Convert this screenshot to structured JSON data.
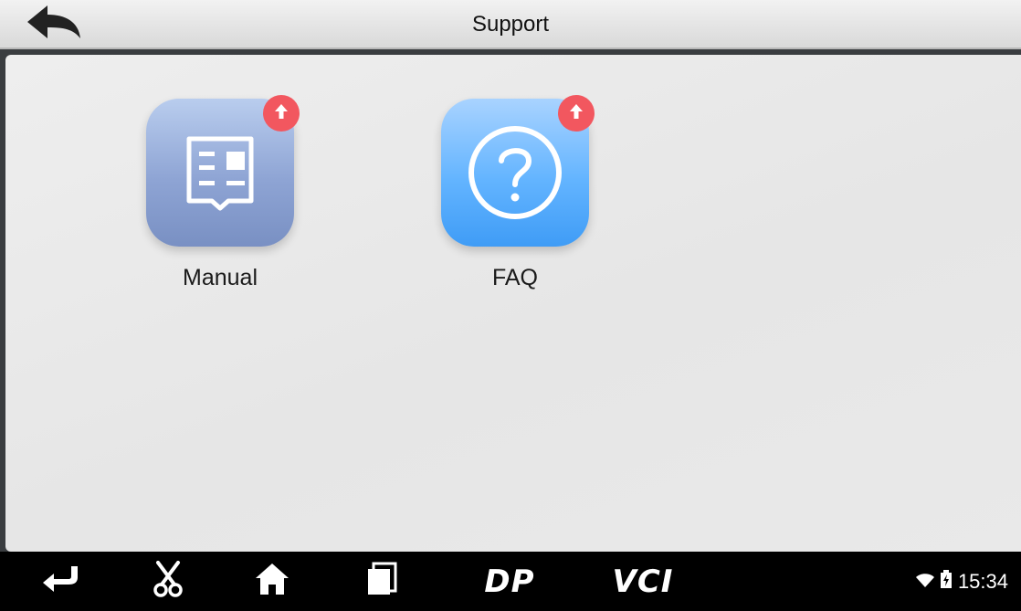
{
  "titlebar": {
    "title": "Support",
    "back_icon": "back-arrow-icon"
  },
  "apps": [
    {
      "label": "Manual",
      "icon": "manual-book-icon",
      "badge_icon": "upgrade-arrow-icon",
      "badge_color": "#f2575f"
    },
    {
      "label": "FAQ",
      "icon": "question-mark-icon",
      "badge_icon": "upgrade-arrow-icon",
      "badge_color": "#f2575f"
    }
  ],
  "navbar": {
    "items": [
      "back-nav-icon",
      "scissors-icon",
      "home-icon",
      "recent-apps-icon",
      "dp-icon",
      "vci-icon"
    ],
    "dp_label": "DP",
    "vci_label": "VCI"
  },
  "status": {
    "time": "15:34",
    "icons": [
      "wifi-icon",
      "battery-icon"
    ]
  },
  "colors": {
    "titlebar": "#e6e6e6",
    "navbar": "#000000",
    "badge": "#f2575f",
    "faq_icon": "#4fa8fa",
    "manual_icon": "#8ea4d4"
  }
}
